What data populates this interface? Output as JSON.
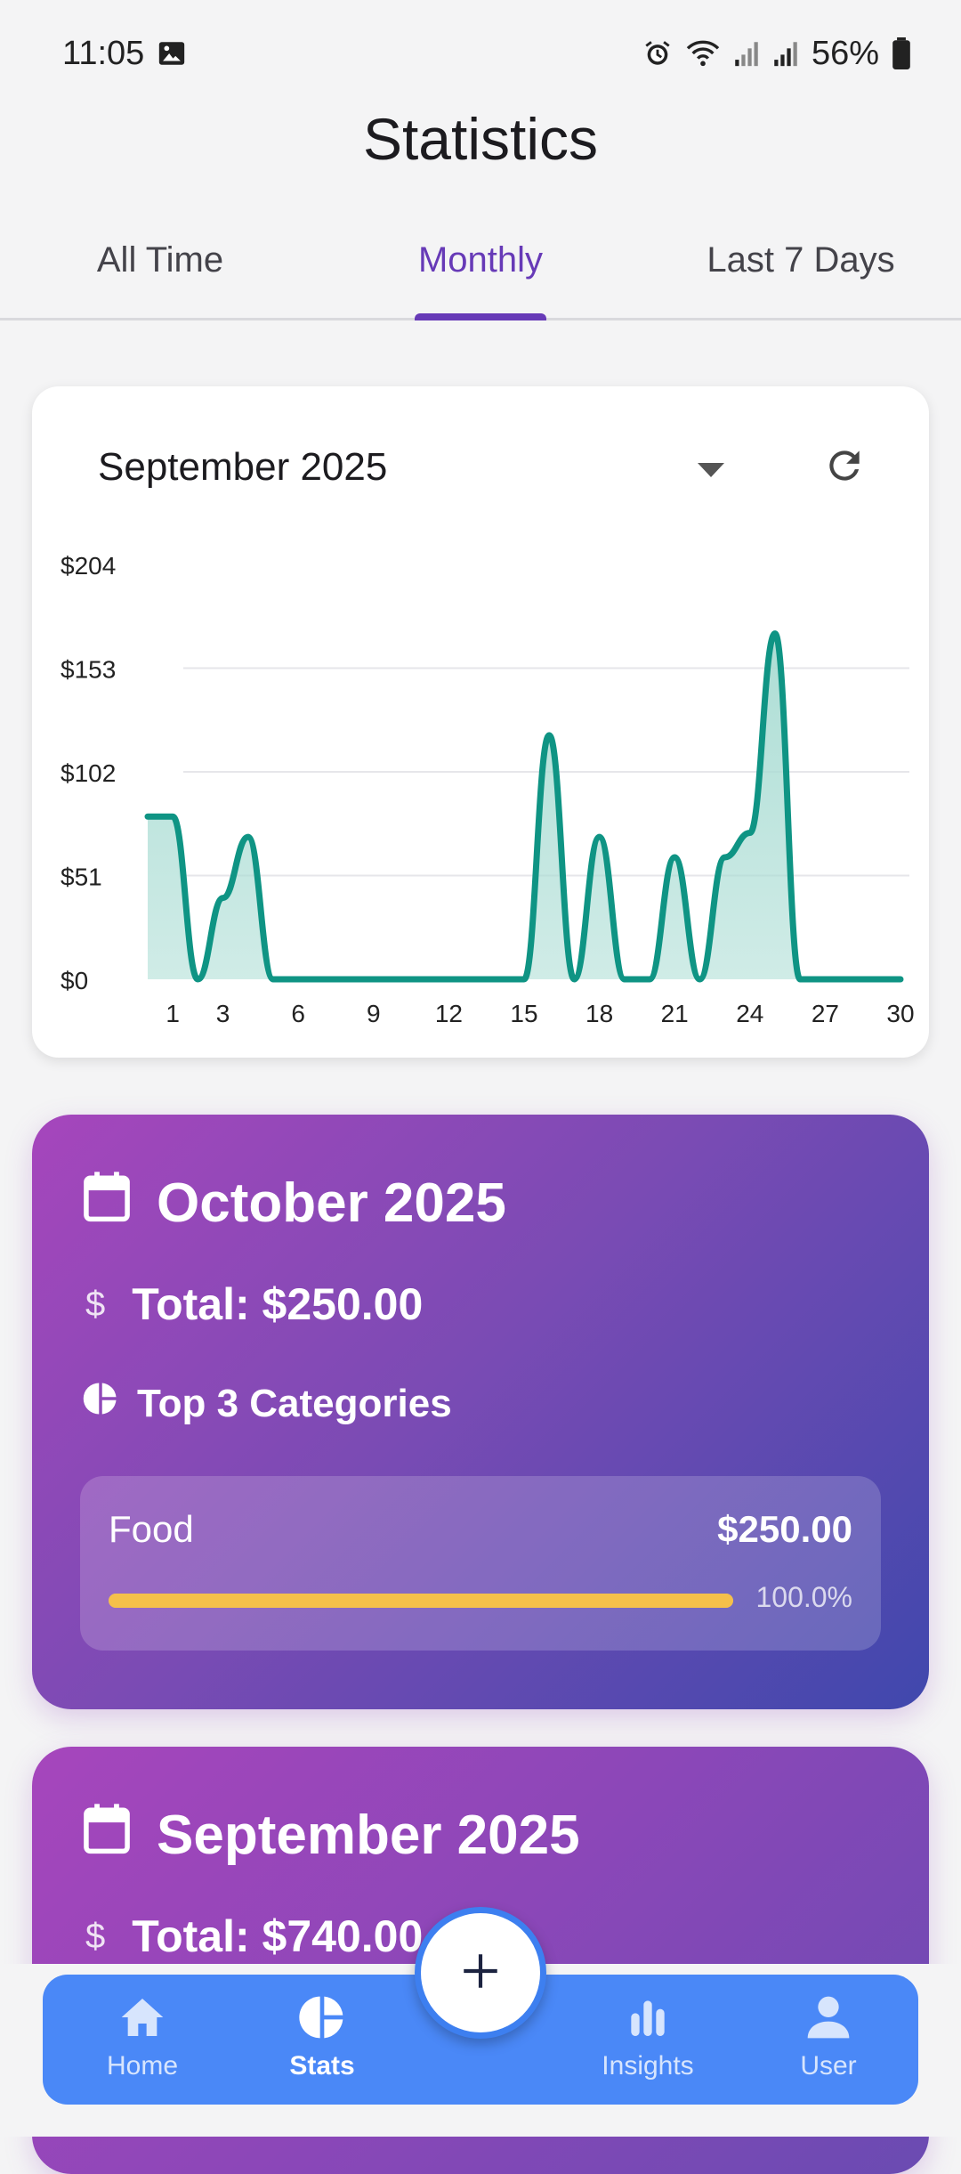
{
  "status_bar": {
    "time": "11:05",
    "battery": "56%"
  },
  "header": {
    "title": "Statistics"
  },
  "tabs": [
    {
      "label": "All Time",
      "active": false
    },
    {
      "label": "Monthly",
      "active": true
    },
    {
      "label": "Last 7 Days",
      "active": false
    }
  ],
  "chart_card": {
    "selected_month": "September 2025"
  },
  "chart_data": {
    "type": "area",
    "x_ticks": [
      "1",
      "3",
      "6",
      "9",
      "12",
      "15",
      "18",
      "21",
      "24",
      "27",
      "30"
    ],
    "y_ticks": [
      "$0",
      "$51",
      "$102",
      "$153",
      "$204"
    ],
    "xlim": [
      0,
      30
    ],
    "ylim": [
      0,
      204
    ],
    "x": [
      0,
      1,
      2,
      3,
      4,
      5,
      6,
      7,
      8,
      9,
      10,
      11,
      12,
      13,
      14,
      15,
      16,
      17,
      18,
      19,
      20,
      21,
      22,
      23,
      24,
      25,
      26,
      27,
      28,
      29,
      30
    ],
    "values": [
      80,
      80,
      0,
      40,
      70,
      0,
      0,
      0,
      0,
      0,
      0,
      0,
      0,
      0,
      0,
      0,
      120,
      0,
      70,
      0,
      0,
      60,
      0,
      60,
      72,
      170,
      0,
      0,
      0,
      0,
      0
    ],
    "line_color": "#0f9484",
    "fill_color": "#a9dcd3",
    "grid": "horizontal"
  },
  "month_cards": [
    {
      "title": "October 2025",
      "total": "Total: $250.00",
      "categories_heading": "Top 3 Categories",
      "categories": [
        {
          "name": "Food",
          "amount": "$250.00",
          "percent_label": "100.0%",
          "fraction": 1.0
        }
      ]
    },
    {
      "title": "September 2025",
      "total": "Total: $740.00"
    }
  ],
  "bottom_nav": [
    {
      "label": "Home",
      "icon": "home-icon",
      "active": false
    },
    {
      "label": "Stats",
      "icon": "pie-chart-icon",
      "active": true
    },
    {
      "label": "Insights",
      "icon": "bar-chart-icon",
      "active": false
    },
    {
      "label": "User",
      "icon": "user-icon",
      "active": false
    }
  ],
  "fab": {
    "icon": "plus-icon"
  },
  "colors": {
    "accent": "#673ab7",
    "nav": "#4a88f7",
    "fab_border": "#3d7ff0",
    "bar": "#f5c04a"
  }
}
